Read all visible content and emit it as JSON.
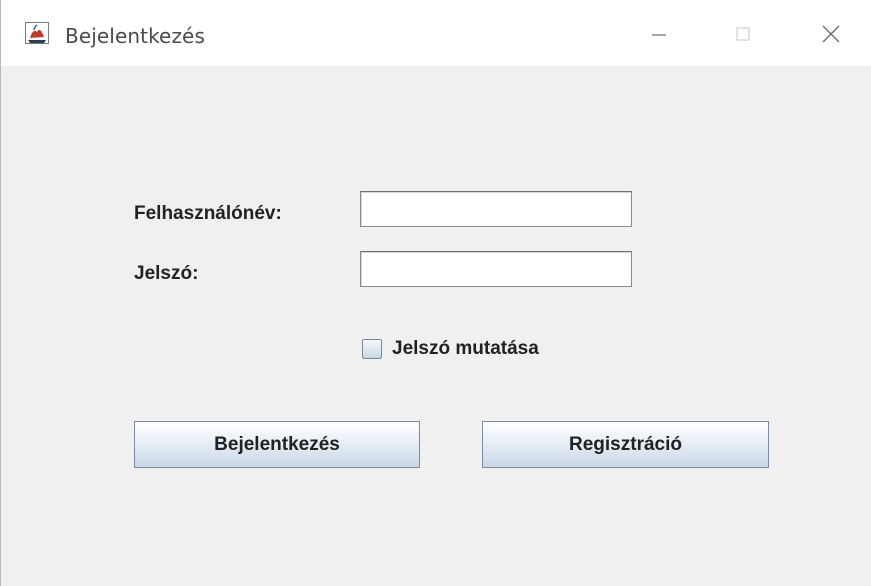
{
  "window": {
    "title": "Bejelentkezés",
    "icon": "java-cup-icon",
    "controls": [
      "minimize-icon",
      "maximize-icon",
      "close-icon"
    ]
  },
  "form": {
    "username_label": "Felhasználónév:",
    "username_value": "",
    "password_label": "Jelszó:",
    "password_value": "",
    "show_password_label": "Jelszó mutatása",
    "show_password_checked": false
  },
  "buttons": {
    "login_label": "Bejelentkezés",
    "register_label": "Regisztráció"
  },
  "colors": {
    "window_bg": "#f0f0f0",
    "titlebar_bg": "#ffffff",
    "button_gradient_top": "#ffffff",
    "button_gradient_bottom": "#c8d7e6",
    "button_border": "#7a8c9d"
  }
}
